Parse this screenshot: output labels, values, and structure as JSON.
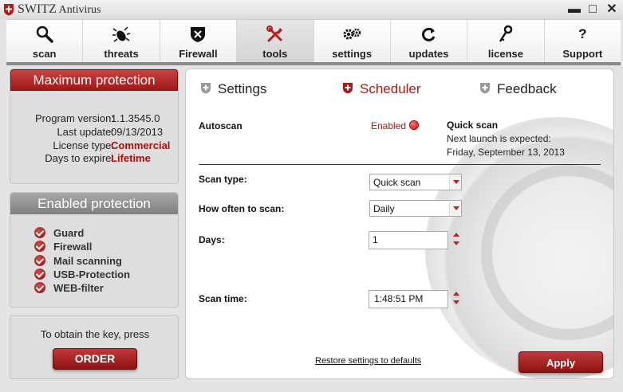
{
  "window": {
    "title_brand": "SWITZ",
    "title_product": " Antivirus",
    "minimize": "▬",
    "maximize": "□",
    "close": "✕"
  },
  "toolbar": {
    "tabs": [
      {
        "label": "scan",
        "icon": "magnifier-icon"
      },
      {
        "label": "threats",
        "icon": "bug-icon"
      },
      {
        "label": "Firewall",
        "icon": "shield-icon"
      },
      {
        "label": "tools",
        "icon": "tools-icon"
      },
      {
        "label": "settings",
        "icon": "gears-icon"
      },
      {
        "label": "updates",
        "icon": "refresh-icon"
      },
      {
        "label": "license",
        "icon": "key-icon"
      },
      {
        "label": "Support",
        "icon": "question-icon"
      }
    ],
    "active_tab": "tools"
  },
  "sidebar": {
    "max_protection": {
      "title": "Maximum protection",
      "rows": [
        {
          "key": "Program version:",
          "value": "1.1.3545.0"
        },
        {
          "key": "Last update:",
          "value": "09/13/2013"
        },
        {
          "key": "License type:",
          "value": "Commercial"
        },
        {
          "key": "Days to expire:",
          "value": "Lifetime"
        }
      ]
    },
    "enabled_protection": {
      "title": "Enabled protection",
      "items": [
        "Guard",
        "Firewall",
        "Mail scanning",
        "USB-Protection",
        "WEB-filter"
      ]
    },
    "order": {
      "text": "To obtain the key, press",
      "button": "ORDER"
    }
  },
  "main": {
    "subtabs": {
      "settings": "Settings",
      "scheduler": "Scheduler",
      "feedback": "Feedback"
    },
    "autoscan": {
      "label": "Autoscan",
      "status": "Enabled",
      "quick_scan_title": "Quick scan",
      "next_launch_label": "Next launch is expected:",
      "next_launch_date": "Friday, September 13, 2013"
    },
    "form": {
      "scan_type_label": "Scan type:",
      "scan_type_value": "Quick scan",
      "how_often_label": "How often to scan:",
      "how_often_value": "Daily",
      "days_label": "Days:",
      "days_value": "1",
      "scan_time_label": "Scan time:",
      "scan_time_value": "1:48:51 PM"
    },
    "restore_link": "Restore settings to defaults",
    "apply_button": "Apply"
  },
  "colors": {
    "accent_red": "#a81a1a",
    "panel_grey": "#dedede"
  }
}
